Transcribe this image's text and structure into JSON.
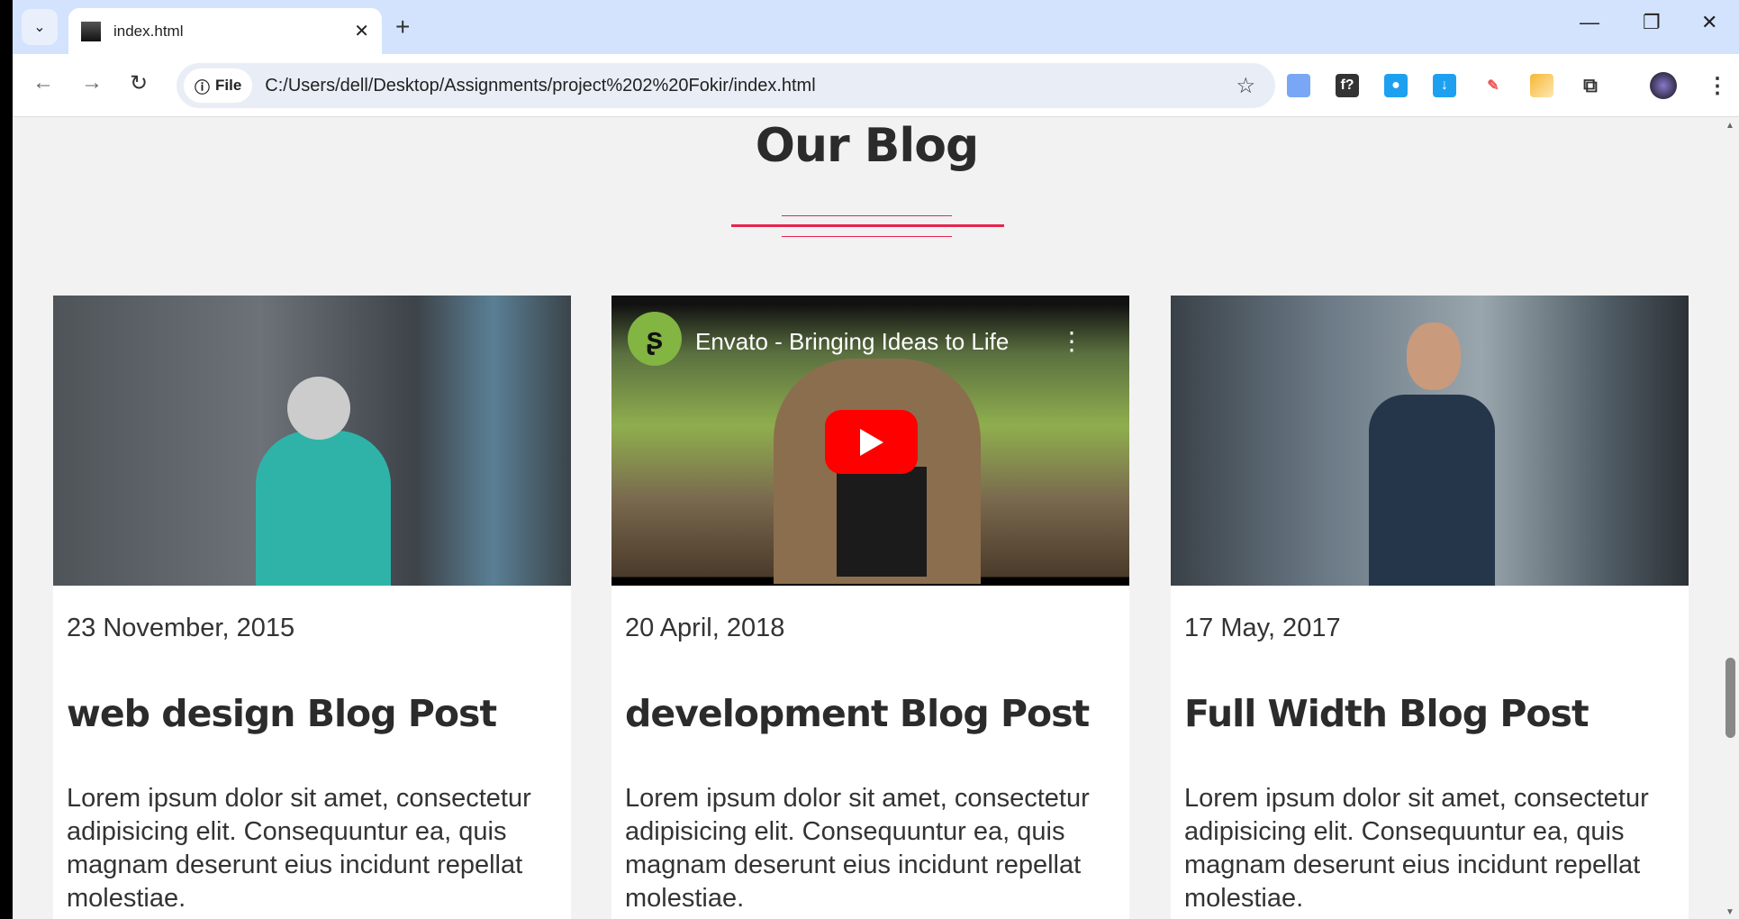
{
  "browser": {
    "tab_title": "index.html",
    "chip_label": "File",
    "url": "C:/Users/dell/Desktop/Assignments/project%202%20Fokir/index.html"
  },
  "section": {
    "title": "Our Blog",
    "accent": "#e8254e"
  },
  "posts": [
    {
      "date": "23 November, 2015",
      "title": "web design Blog Post",
      "body": "Lorem ipsum dolor sit amet, consectetur adipisicing elit. Consequuntur ea, quis magnam deserunt eius incidunt repellat molestiae."
    },
    {
      "date": "20 April, 2018",
      "title": "development Blog Post",
      "body": "Lorem ipsum dolor sit amet, consectetur adipisicing elit. Consequuntur ea, quis magnam deserunt eius incidunt repellat molestiae.",
      "video_title": "Envato - Bringing Ideas to Life"
    },
    {
      "date": "17 May, 2017",
      "title": "Full Width Blog Post",
      "body": "Lorem ipsum dolor sit amet, consectetur adipisicing elit. Consequuntur ea, quis magnam deserunt eius incidunt repellat molestiae."
    }
  ]
}
